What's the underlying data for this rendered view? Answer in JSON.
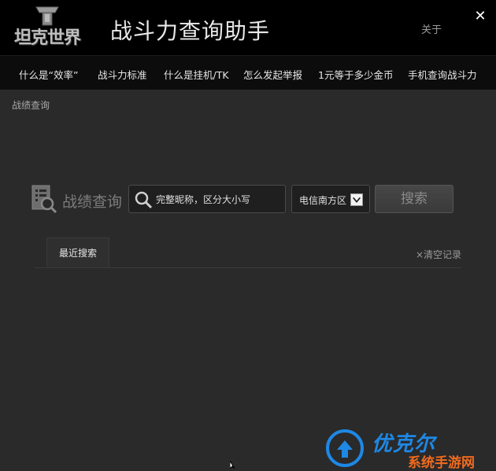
{
  "header": {
    "logo_text": "坦克世界",
    "title": "战斗力查询助手",
    "about": "关于",
    "close_glyph": "✕"
  },
  "nav": [
    {
      "label": "什么是“效率”"
    },
    {
      "label": "战斗力标准"
    },
    {
      "label": "什么是挂机/TK"
    },
    {
      "label": "怎么发起举报"
    },
    {
      "label": "1元等于多少金币"
    },
    {
      "label": "手机查询战斗力"
    }
  ],
  "breadcrumb": "战绩查询",
  "search": {
    "label": "战绩查询",
    "placeholder": "完整昵称，区分大小写",
    "server": "电信南方区",
    "button": "搜索"
  },
  "recent": {
    "tab": "最近搜索",
    "clear": "×清空记录"
  },
  "watermark": {
    "brand": "优克尔",
    "sub": "系统手游网"
  },
  "colors": {
    "background": "#2a2a2a",
    "titlebar": "#000000",
    "navbar": "#0c0c0c",
    "watermark_blue": "#1e88e5",
    "watermark_orange": "#f26b1d"
  }
}
